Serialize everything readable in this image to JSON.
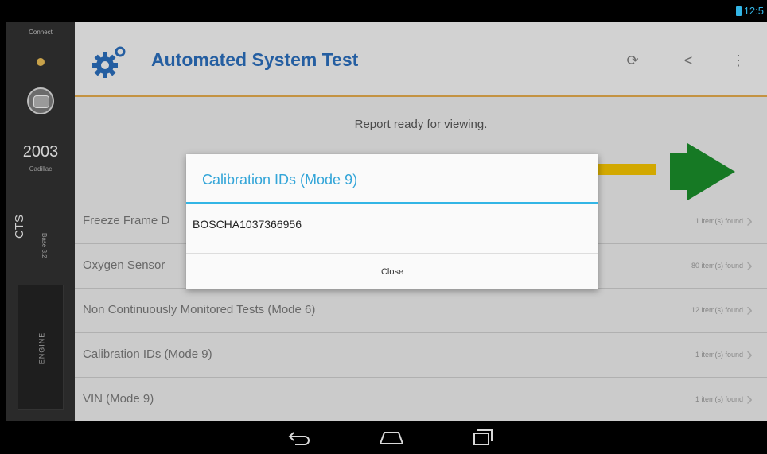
{
  "status_bar": {
    "time": "12:5"
  },
  "sidebar": {
    "connect_label": "Connect",
    "year": "2003",
    "make": "Cadillac",
    "model": "CTS",
    "sub": "Base 3.2",
    "engine_label": "ENGINE"
  },
  "app": {
    "title": "Automated System Test",
    "report_text": "Report ready for viewing.",
    "icons": {
      "refresh": "refresh-icon",
      "share": "share-icon",
      "overflow": "overflow-menu-icon"
    }
  },
  "list_items": [
    {
      "label": "Freeze Frame D",
      "count": "1 item(s) found"
    },
    {
      "label": "Oxygen Sensor",
      "count": "80 item(s) found"
    },
    {
      "label": "Non Continuously Monitored Tests (Mode 6)",
      "count": "12 item(s) found"
    },
    {
      "label": "Calibration IDs (Mode 9)",
      "count": "1 item(s) found"
    },
    {
      "label": "VIN (Mode 9)",
      "count": "1 item(s) found"
    }
  ],
  "dialog": {
    "title": "Calibration IDs (Mode 9)",
    "body": "BOSCHA1037366956",
    "close_label": "Close"
  },
  "colors": {
    "accent": "#33b5e5",
    "title_blue": "#2a6bb8",
    "progress": "#f0c000",
    "arrow": "#1a8a2a"
  },
  "nav": {
    "back": "back-icon",
    "home": "home-icon",
    "recents": "recents-icon"
  }
}
